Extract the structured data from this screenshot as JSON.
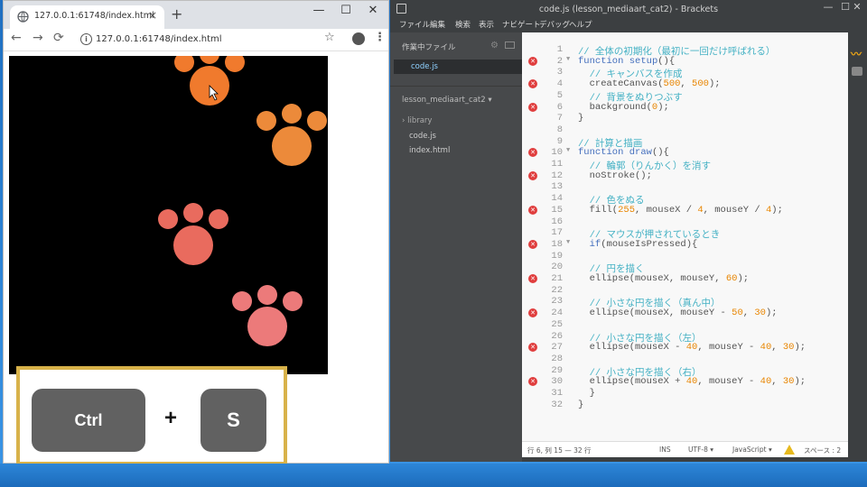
{
  "browser": {
    "tab_title": "127.0.0.1:61748/index.html",
    "url": "127.0.0.1:61748/index.html",
    "new_tab": "+",
    "tab_close": "×",
    "minimize": "—",
    "maximize": "☐",
    "close": "✕",
    "back": "←",
    "forward": "→",
    "reload": "⟳",
    "info": "i",
    "star": "☆",
    "menu": "⋮"
  },
  "paws": {
    "colors": [
      "#f07a2d",
      "#ec8a3a",
      "#e96b5e",
      "#ec7a7a"
    ]
  },
  "keys": {
    "ctrl": "Ctrl",
    "plus": "+",
    "s": "S"
  },
  "brackets": {
    "window_title": "code.js (lesson_mediaart_cat2) - Brackets",
    "minimize": "—",
    "maximize": "☐",
    "close": "✕",
    "menu": [
      "ファイル",
      "編集",
      "検索",
      "表示",
      "ナビゲート",
      "デバッグ",
      "ヘルプ"
    ],
    "working_files_header": "作業中ファイル",
    "working_file": "code.js",
    "project": "lesson_mediaart_cat2 ▾",
    "tree": [
      "› library",
      "code.js",
      "index.html"
    ],
    "code_lines": [
      {
        "n": "1",
        "err": false,
        "fold": false,
        "html": "<span class='cm'>// 全体の初期化（最初に一回だけ呼ばれる）</span>"
      },
      {
        "n": "2",
        "err": true,
        "fold": true,
        "html": "<span class='kw'>function</span> <span class='kw'>setup</span>(){"
      },
      {
        "n": "3",
        "err": false,
        "fold": false,
        "html": "  <span class='cm'>// キャンバスを作成</span>"
      },
      {
        "n": "4",
        "err": true,
        "fold": false,
        "html": "  createCanvas(<span class='num'>500</span>, <span class='num'>500</span>);"
      },
      {
        "n": "5",
        "err": false,
        "fold": false,
        "html": "  <span class='cm'>// 背景をぬりつぶす</span>"
      },
      {
        "n": "6",
        "err": true,
        "fold": false,
        "html": "  background(<span class='num'>0</span>);"
      },
      {
        "n": "7",
        "err": false,
        "fold": false,
        "html": "}"
      },
      {
        "n": "8",
        "err": false,
        "fold": false,
        "html": ""
      },
      {
        "n": "9",
        "err": false,
        "fold": false,
        "html": "<span class='cm'>// 計算と描画</span>"
      },
      {
        "n": "10",
        "err": true,
        "fold": true,
        "html": "<span class='kw'>function</span> <span class='kw'>draw</span>(){"
      },
      {
        "n": "11",
        "err": false,
        "fold": false,
        "html": "  <span class='cm'>// 輪郭（りんかく）を消す</span>"
      },
      {
        "n": "12",
        "err": true,
        "fold": false,
        "html": "  noStroke();"
      },
      {
        "n": "13",
        "err": false,
        "fold": false,
        "html": ""
      },
      {
        "n": "14",
        "err": false,
        "fold": false,
        "html": "  <span class='cm'>// 色をぬる</span>"
      },
      {
        "n": "15",
        "err": true,
        "fold": false,
        "html": "  fill(<span class='num'>255</span>, mouseX / <span class='num'>4</span>, mouseY / <span class='num'>4</span>);"
      },
      {
        "n": "16",
        "err": false,
        "fold": false,
        "html": ""
      },
      {
        "n": "17",
        "err": false,
        "fold": false,
        "html": "  <span class='cm'>// マウスが押されているとき</span>"
      },
      {
        "n": "18",
        "err": true,
        "fold": true,
        "html": "  <span class='kw'>if</span>(mouseIsPressed){"
      },
      {
        "n": "19",
        "err": false,
        "fold": false,
        "html": ""
      },
      {
        "n": "20",
        "err": false,
        "fold": false,
        "html": "  <span class='cm'>// 円を描く</span>"
      },
      {
        "n": "21",
        "err": true,
        "fold": false,
        "html": "  ellipse(mouseX, mouseY, <span class='num'>60</span>);"
      },
      {
        "n": "22",
        "err": false,
        "fold": false,
        "html": ""
      },
      {
        "n": "23",
        "err": false,
        "fold": false,
        "html": "  <span class='cm'>// 小さな円を描く（真ん中）</span>"
      },
      {
        "n": "24",
        "err": true,
        "fold": false,
        "html": "  ellipse(mouseX, mouseY - <span class='num'>50</span>, <span class='num'>30</span>);"
      },
      {
        "n": "25",
        "err": false,
        "fold": false,
        "html": ""
      },
      {
        "n": "26",
        "err": false,
        "fold": false,
        "html": "  <span class='cm'>// 小さな円を描く（左）</span>"
      },
      {
        "n": "27",
        "err": true,
        "fold": false,
        "html": "  ellipse(mouseX - <span class='num'>40</span>, mouseY - <span class='num'>40</span>, <span class='num'>30</span>);"
      },
      {
        "n": "28",
        "err": false,
        "fold": false,
        "html": ""
      },
      {
        "n": "29",
        "err": false,
        "fold": false,
        "html": "  <span class='cm'>// 小さな円を描く（右）</span>"
      },
      {
        "n": "30",
        "err": true,
        "fold": false,
        "html": "  ellipse(mouseX + <span class='num'>40</span>, mouseY - <span class='num'>40</span>, <span class='num'>30</span>);"
      },
      {
        "n": "31",
        "err": false,
        "fold": false,
        "html": "  }"
      },
      {
        "n": "32",
        "err": false,
        "fold": false,
        "html": "}"
      }
    ],
    "status": {
      "position": "行 6, 列 15 — 32 行",
      "ins": "INS",
      "encoding": "UTF-8 ▾",
      "language": "JavaScript ▾",
      "spaces": "スペース : 2"
    }
  }
}
